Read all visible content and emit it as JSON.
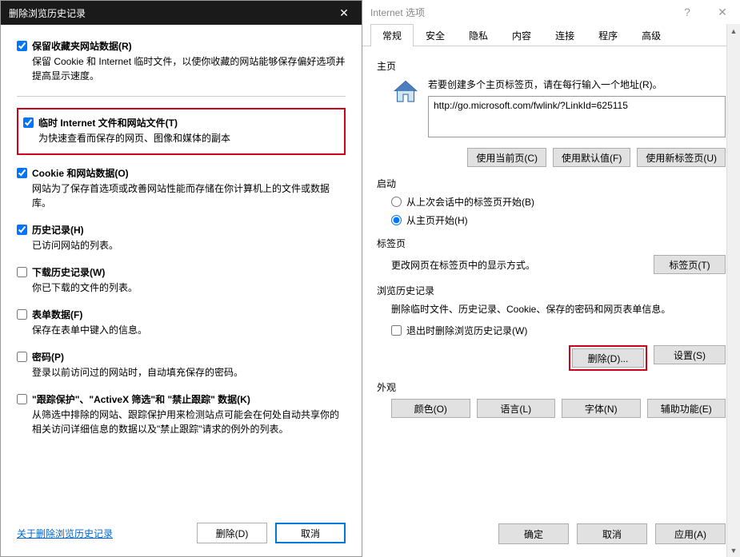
{
  "leftDialog": {
    "title": "删除浏览历史记录",
    "options": {
      "preserveFavorites": {
        "label": "保留收藏夹网站数据(R)",
        "desc": "保留 Cookie 和 Internet 临时文件，以使你收藏的网站能够保存偏好选项并提高显示速度。",
        "checked": true
      },
      "tempInternet": {
        "label": "临时 Internet 文件和网站文件(T)",
        "desc": "为快速查看而保存的网页、图像和媒体的副本",
        "checked": true
      },
      "cookies": {
        "label": "Cookie 和网站数据(O)",
        "desc": "网站为了保存首选项或改善网站性能而存储在你计算机上的文件或数据库。",
        "checked": true
      },
      "history": {
        "label": "历史记录(H)",
        "desc": "已访问网站的列表。",
        "checked": true
      },
      "downloads": {
        "label": "下载历史记录(W)",
        "desc": "你已下载的文件的列表。",
        "checked": false
      },
      "formData": {
        "label": "表单数据(F)",
        "desc": "保存在表单中键入的信息。",
        "checked": false
      },
      "passwords": {
        "label": "密码(P)",
        "desc": "登录以前访问过的网站时，自动填充保存的密码。",
        "checked": false
      },
      "tracking": {
        "label": "\"跟踪保护\"、\"ActiveX 筛选\"和 \"禁止跟踪\" 数据(K)",
        "desc": "从筛选中排除的网站、跟踪保护用来检测站点可能会在何处自动共享你的相关访问详细信息的数据以及\"禁止跟踪\"请求的例外的列表。",
        "checked": false
      }
    },
    "linkText": "关于删除浏览历史记录",
    "deleteBtn": "删除(D)",
    "cancelBtn": "取消"
  },
  "rightDialog": {
    "title": "Internet 选项",
    "tabs": [
      "常规",
      "安全",
      "隐私",
      "内容",
      "连接",
      "程序",
      "高级"
    ],
    "homepage": {
      "title": "主页",
      "desc": "若要创建多个主页标签页，请在每行输入一个地址(R)。",
      "url": "http://go.microsoft.com/fwlink/?LinkId=625115",
      "useCurrent": "使用当前页(C)",
      "useDefault": "使用默认值(F)",
      "useNewTab": "使用新标签页(U)"
    },
    "startup": {
      "title": "启动",
      "fromLast": "从上次会话中的标签页开始(B)",
      "fromHome": "从主页开始(H)"
    },
    "tabpage": {
      "title": "标签页",
      "desc": "更改网页在标签页中的显示方式。",
      "btn": "标签页(T)"
    },
    "browseHistory": {
      "title": "浏览历史记录",
      "desc": "删除临时文件、历史记录、Cookie、保存的密码和网页表单信息。",
      "exitDelete": "退出时删除浏览历史记录(W)",
      "deleteBtn": "删除(D)...",
      "settingsBtn": "设置(S)"
    },
    "appearance": {
      "title": "外观",
      "color": "颜色(O)",
      "lang": "语言(L)",
      "font": "字体(N)",
      "aux": "辅助功能(E)"
    },
    "footer": {
      "ok": "确定",
      "cancel": "取消",
      "apply": "应用(A)"
    }
  }
}
